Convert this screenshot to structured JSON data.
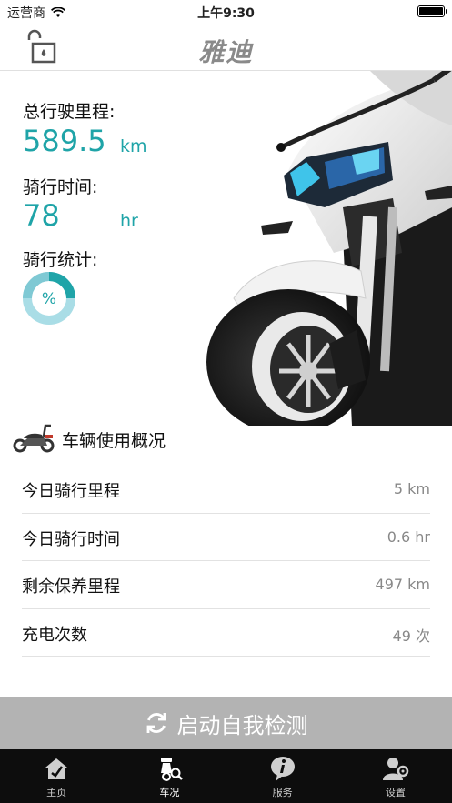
{
  "status_bar": {
    "carrier": "运营商",
    "time": "上午9:30"
  },
  "header": {
    "brand": "雅迪"
  },
  "stats": {
    "total_mileage_label": "总行驶里程:",
    "total_mileage_value": "589.5",
    "total_mileage_unit": "km",
    "ride_time_label": "骑行时间:",
    "ride_time_value": "78",
    "ride_time_unit": "hr",
    "ride_stats_label": "骑行统计:",
    "ring_text": "%"
  },
  "overview": {
    "title": "车辆使用概况",
    "rows": [
      {
        "label": "今日骑行里程",
        "value": "5 km"
      },
      {
        "label": "今日骑行时间",
        "value": "0.6 hr"
      },
      {
        "label": "剩余保养里程",
        "value": "497 km"
      },
      {
        "label": "充电次数",
        "value": "49 次"
      }
    ]
  },
  "detect_button": {
    "label": "启动自我检测"
  },
  "tabs": [
    {
      "label": "主页",
      "icon": "home-icon"
    },
    {
      "label": "车况",
      "icon": "scooter-search-icon"
    },
    {
      "label": "服务",
      "icon": "info-icon"
    },
    {
      "label": "设置",
      "icon": "user-settings-icon"
    }
  ],
  "colors": {
    "accent": "#1fa4a8",
    "tab_bar": "#0d0d0d",
    "button": "#b3b3b3"
  }
}
